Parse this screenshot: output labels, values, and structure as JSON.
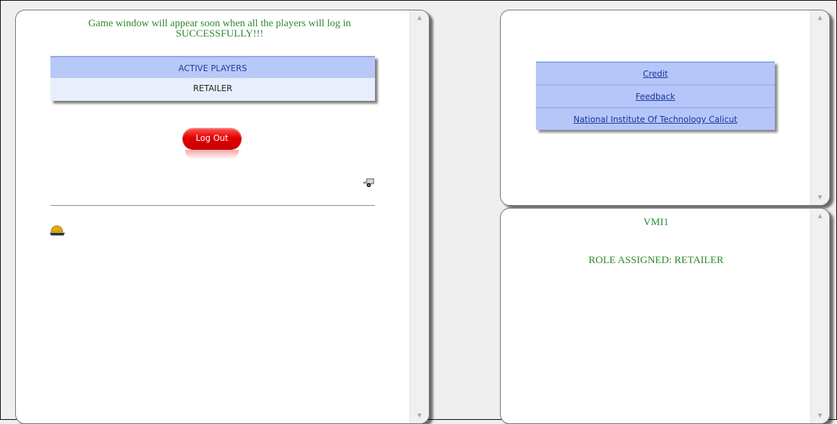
{
  "left_panel": {
    "wait_message": "Game window will appear soon when all the players will log in SUCCESSFULLY!!!",
    "players_table": {
      "header": "ACTIVE PLAYERS",
      "rows": [
        "RETAILER"
      ]
    },
    "logout_button": "Log Out"
  },
  "top_right_panel": {
    "links": [
      "Credit",
      "Feedback",
      "National Institute Of Technology Calicut"
    ]
  },
  "bottom_right_panel": {
    "title": "VMI1",
    "role_text": "ROLE ASSIGNED: RETAILER"
  },
  "colors": {
    "text_green": "#2d8a2d",
    "table_blue": "#b6c6f8",
    "logout_red": "#e40000"
  },
  "icons": {
    "truck": "small-truck-icon",
    "hardhat": "hardhat-icon"
  }
}
